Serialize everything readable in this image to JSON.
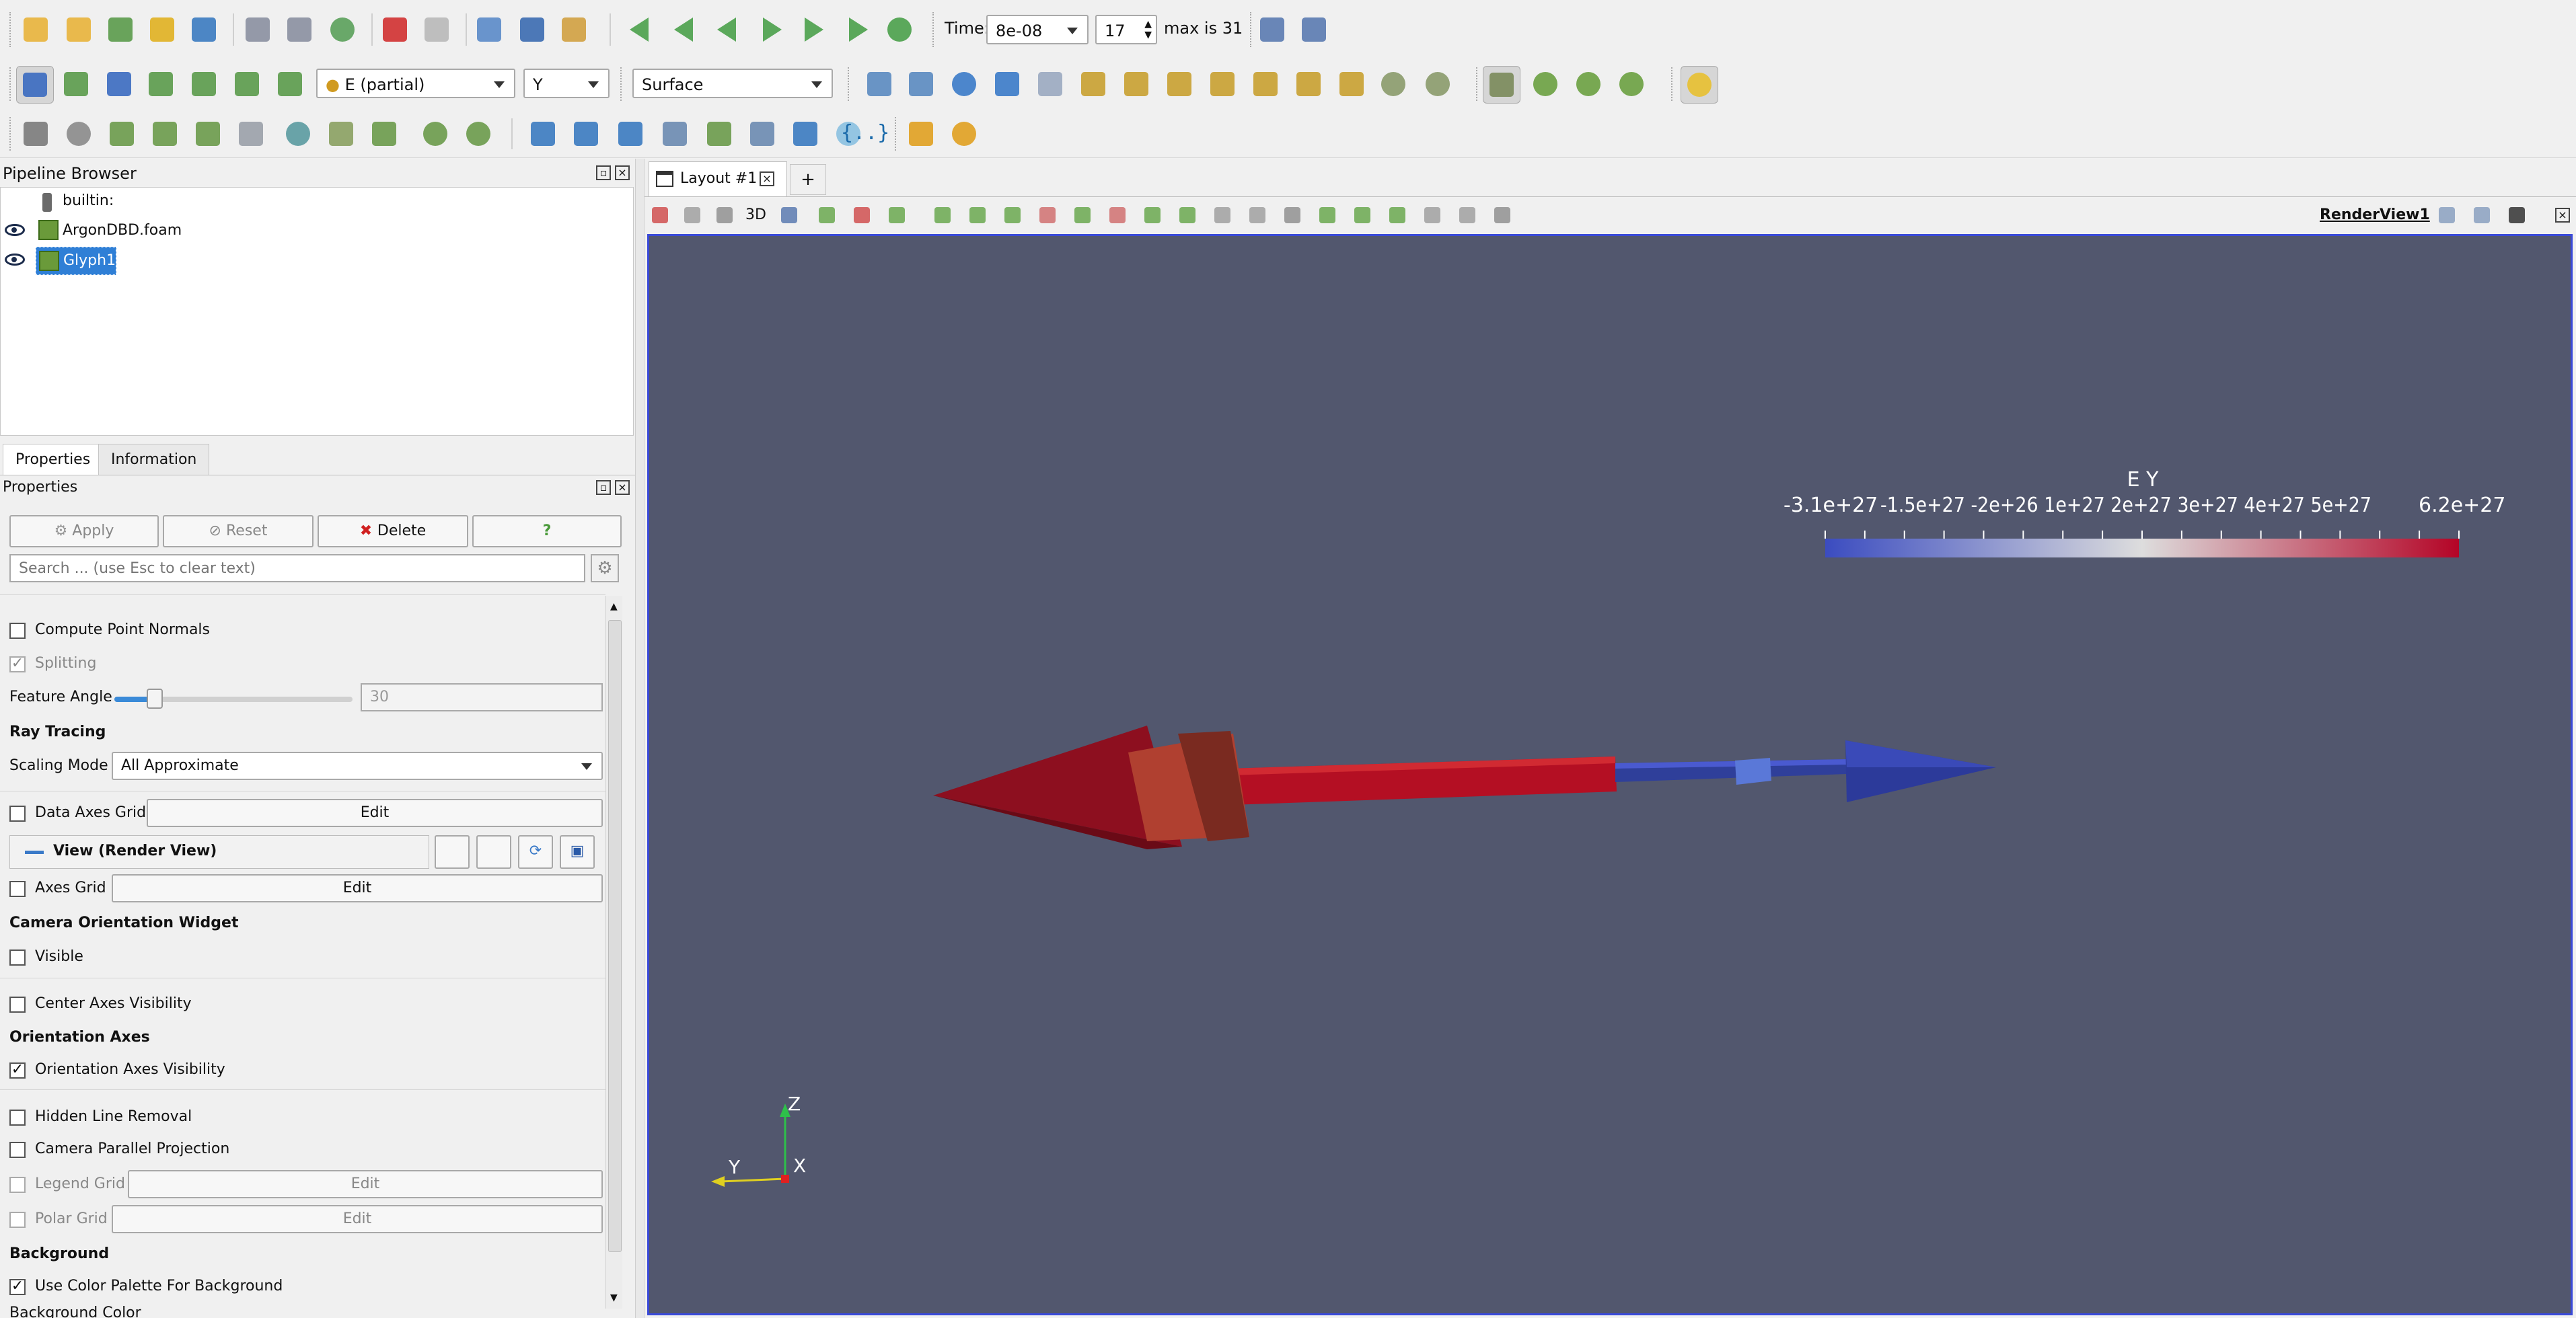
{
  "time_toolbar": {
    "time_label": "Time:",
    "time_value": "8e-08",
    "step_value": "17",
    "max_label": "max is 31"
  },
  "display_toolbar": {
    "color_field": "E (partial)",
    "component": "Y",
    "representation": "Surface"
  },
  "pipeline": {
    "title": "Pipeline Browser",
    "items": [
      {
        "label": "builtin:"
      },
      {
        "label": "ArgonDBD.foam"
      },
      {
        "label": "Glyph1"
      }
    ]
  },
  "tabs": [
    {
      "label": "Properties"
    },
    {
      "label": "Information"
    }
  ],
  "properties": {
    "title": "Properties",
    "apply": "Apply",
    "reset": "Reset",
    "delete": "Delete",
    "help": "?",
    "search_placeholder": "Search ... (use Esc to clear text)",
    "compute_point_normals": "Compute Point Normals",
    "splitting": "Splitting",
    "feature_angle_label": "Feature Angle",
    "feature_angle_value": "30",
    "feature_angle_fraction": 0.17,
    "ray_tracing": "Ray Tracing",
    "scaling_mode_label": "Scaling Mode",
    "scaling_mode_value": "All Approximate",
    "data_axes_grid": "Data Axes Grid",
    "edit": "Edit",
    "view_section": "View (Render View)",
    "axes_grid": "Axes Grid",
    "camera_orientation_widget": "Camera Orientation Widget",
    "visible": "Visible",
    "center_axes_visibility": "Center Axes Visibility",
    "orientation_axes": "Orientation Axes",
    "orientation_axes_visibility": "Orientation Axes Visibility",
    "hidden_line_removal": "Hidden Line Removal",
    "camera_parallel_projection": "Camera Parallel Projection",
    "legend_grid": "Legend Grid",
    "polar_grid": "Polar Grid",
    "background": "Background",
    "use_color_palette": "Use Color Palette For Background",
    "background_color": "Background Color"
  },
  "layout": {
    "tab_label": "Layout #1",
    "add_tab": "+",
    "view_3d": "3D",
    "render_view_name": "RenderView1"
  },
  "scalar_bar": {
    "title": "E Y",
    "min_label": "-3.1e+27",
    "max_label": "6.2e+27",
    "mid_labels": "-1.5e+27 -2e+26 1e+27 2e+27 3e+27 4e+27 5e+27",
    "color_low": "#3b4cc0",
    "color_high": "#b40426"
  },
  "axes": {
    "z": "Z",
    "y": "Y",
    "x": "X"
  },
  "colors": {
    "render_bg": "#52576e",
    "selection": "#2f7fd6"
  }
}
